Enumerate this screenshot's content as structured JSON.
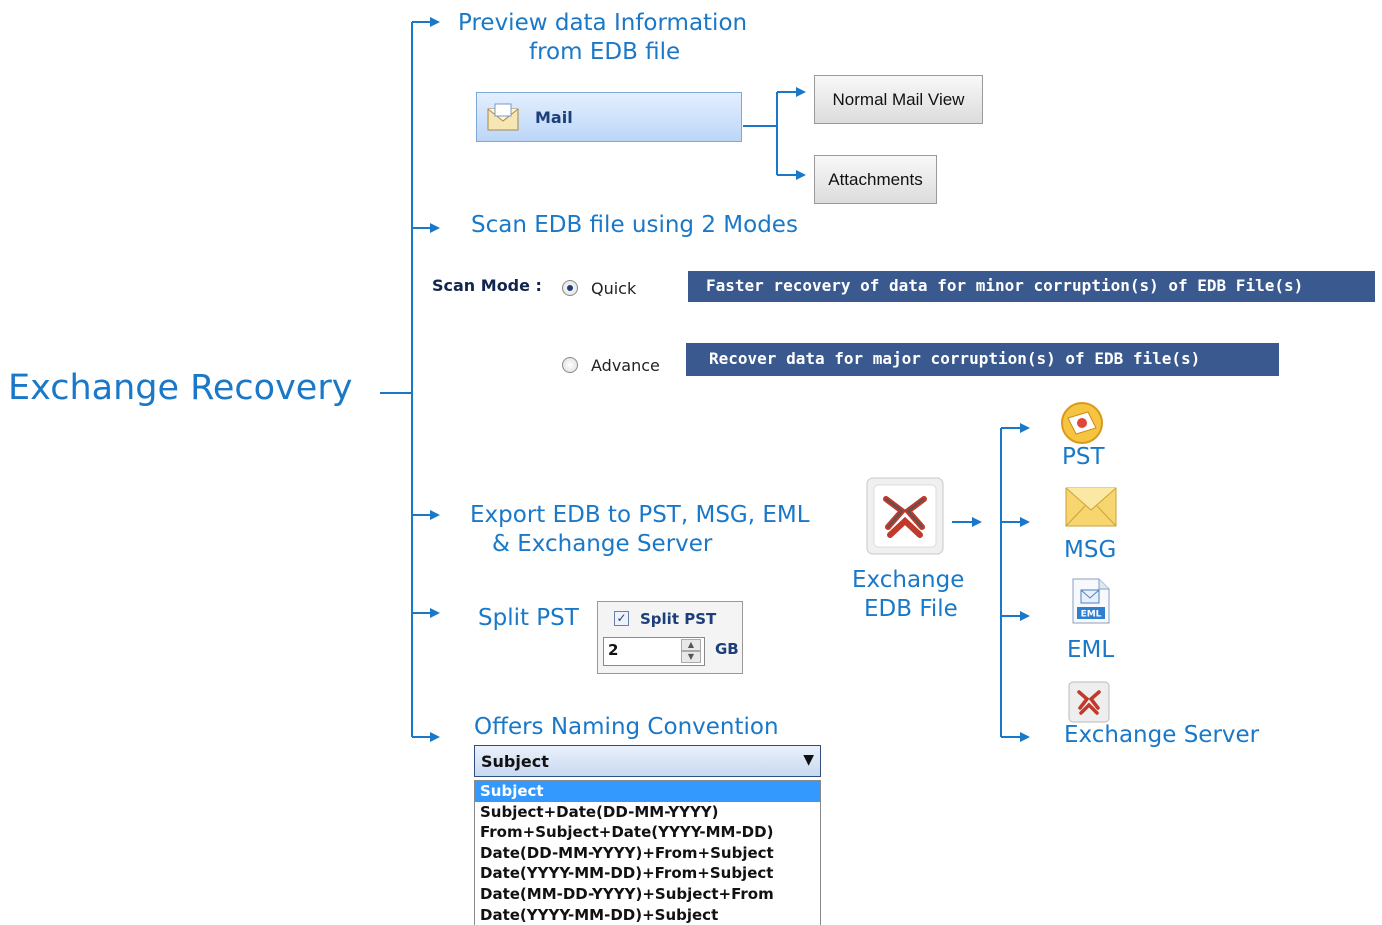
{
  "root": {
    "title": "Exchange Recovery"
  },
  "branches": {
    "preview": {
      "title_line1": "Preview data Information",
      "title_line2": "from EDB file",
      "mail_label": "Mail",
      "normal_mail_view": "Normal Mail View",
      "attachments": "Attachments"
    },
    "scan": {
      "title": "Scan EDB file using 2 Modes",
      "mode_label": "Scan Mode :",
      "quick_label": "Quick",
      "advance_label": "Advance",
      "quick_selected": true,
      "quick_desc": "Faster recovery of data for minor corruption(s) of EDB File(s)",
      "advance_desc": "Recover data for major corruption(s) of EDB file(s)"
    },
    "export": {
      "title_line1": "Export EDB to PST, MSG, EML",
      "title_line2": "& Exchange Server",
      "source_line1": "Exchange",
      "source_line2": "EDB File",
      "targets": [
        "PST",
        "MSG",
        "EML",
        "Exchange Server"
      ]
    },
    "split": {
      "title": "Split PST",
      "checkbox_label": "Split PST",
      "checked": true,
      "size_value": "2",
      "unit": "GB"
    },
    "naming": {
      "title": "Offers Naming Convention",
      "selected": "Subject",
      "options": [
        "Subject",
        "Subject+Date(DD-MM-YYYY)",
        "From+Subject+Date(YYYY-MM-DD)",
        "Date(DD-MM-YYYY)+From+Subject",
        "Date(YYYY-MM-DD)+From+Subject",
        "Date(MM-DD-YYYY)+Subject+From",
        "Date(YYYY-MM-DD)+Subject"
      ]
    }
  },
  "colors": {
    "accent": "#1a78c8",
    "banner": "#3a5a8f",
    "selection": "#3399ff"
  },
  "icons": {
    "mail": "mail-envelope-icon",
    "exchange": "exchange-logo-icon",
    "pst": "outlook-pst-icon",
    "msg": "envelope-icon",
    "eml": "eml-file-icon",
    "server": "exchange-server-icon"
  }
}
